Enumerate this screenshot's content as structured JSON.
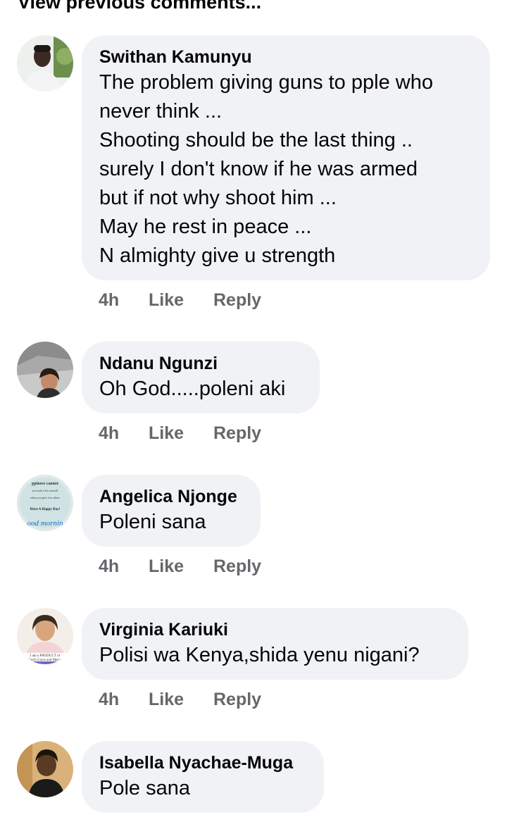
{
  "view_previous": "View previous comments...",
  "actions": {
    "like": "Like",
    "reply": "Reply"
  },
  "comments": [
    {
      "author": "Swithan Kamunyu",
      "text": "The problem giving guns to pple who\nnever think ...\nShooting should be the last thing ..\nsurely I don't know if he was armed\nbut if not why shoot him ...\nMay he rest in peace ...\nN almighty give u strength",
      "time": "4h"
    },
    {
      "author": "Ndanu Ngunzi",
      "text": "Oh God.....poleni aki",
      "time": "4h"
    },
    {
      "author": "Angelica Njonge",
      "text": "Poleni sana",
      "time": "4h",
      "avatar_text": [
        "ppiness cannot",
        "you seek it for yourself",
        "when you give it to others",
        "Have A Happy Day!",
        "ood mornin"
      ]
    },
    {
      "author": "Virginia Kariuki",
      "text": "Polisi wa Kenya,shida yenu nigani?",
      "time": "4h",
      "avatar_text": [
        "I am a PRODUCT of",
        "God's Grace and Mercy"
      ]
    },
    {
      "author": "Isabella Nyachae-Muga",
      "text": "Pole sana"
    }
  ]
}
